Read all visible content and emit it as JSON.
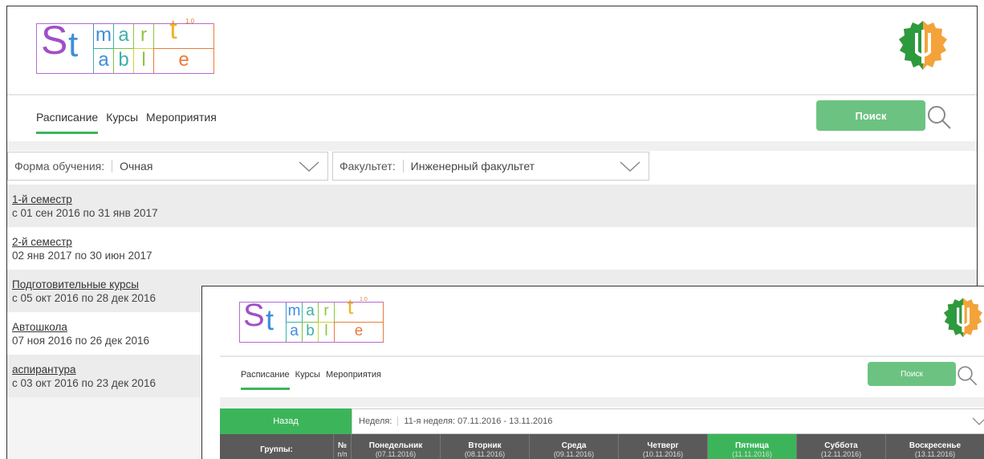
{
  "brand": {
    "logo_letters": {
      "S": "S",
      "t": "t",
      "m": "m",
      "a1": "a",
      "r": "r",
      "t2": "t",
      "a2": "a",
      "b": "b",
      "l": "l",
      "e": "e",
      "sup": "1.0"
    },
    "colors": {
      "accent_green": "#3cb55a",
      "search_green": "#6cc381",
      "header_grey": "#5a5a5a"
    }
  },
  "back": {
    "nav": [
      {
        "label": "Расписание",
        "active": true
      },
      {
        "label": "Курсы",
        "active": false
      },
      {
        "label": "Мероприятия",
        "active": false
      }
    ],
    "search_label": "Поиск",
    "filters": {
      "form_label": "Форма обучения:",
      "form_value": "Очная",
      "faculty_label": "Факультет:",
      "faculty_value": "Инженерный факультет"
    },
    "semesters": [
      {
        "title": "1-й семестр",
        "dates": "с 01 сен 2016 по 31 янв 2017"
      },
      {
        "title": "2-й семестр",
        "dates": "02 янв 2017 по 30 июн 2017"
      },
      {
        "title": "Подготовительные курсы",
        "dates": "с 05 окт 2016 по 28 дек 2016"
      },
      {
        "title": "Автошкола",
        "dates": "07 ноя 2016 по 26 дек 2016"
      },
      {
        "title": "аспирантура",
        "dates": "с 03 окт 2016 по 23 дек 2016"
      }
    ]
  },
  "front": {
    "nav": [
      {
        "label": "Расписание",
        "active": true
      },
      {
        "label": "Курсы",
        "active": false
      },
      {
        "label": "Мероприятия",
        "active": false
      }
    ],
    "search_label": "Поиск",
    "back_label": "Назад",
    "week_label": "Неделя:",
    "week_value": "11-я неделя: 07.11.2016 - 13.11.2016",
    "table_headers": [
      {
        "label": "Группы:",
        "sub": ""
      },
      {
        "label": "№",
        "sub": "п/п"
      },
      {
        "label": "Понедельник",
        "sub": "(07.11.2016)"
      },
      {
        "label": "Вторник",
        "sub": "(08.11.2016)"
      },
      {
        "label": "Среда",
        "sub": "(09.11.2016)"
      },
      {
        "label": "Четверг",
        "sub": "(10.11.2016)"
      },
      {
        "label": "Пятница",
        "sub": "(11.11.2016)",
        "today": true
      },
      {
        "label": "Суббота",
        "sub": "(12.11.2016)"
      },
      {
        "label": "Воскресенье",
        "sub": "(13.11.2016)"
      }
    ]
  }
}
